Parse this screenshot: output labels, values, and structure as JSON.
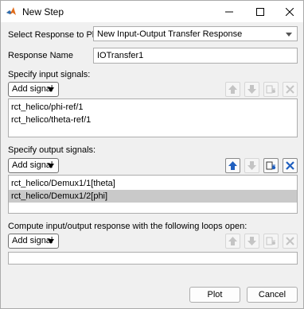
{
  "window": {
    "title": "New Step"
  },
  "response": {
    "label": "Select Response to Plot",
    "selected": "New Input-Output Transfer Response"
  },
  "name": {
    "label": "Response Name",
    "value": "IOTransfer1"
  },
  "inputs": {
    "heading": "Specify input signals:",
    "add_label": "Add signal",
    "items": [
      "rct_helico/phi-ref/1",
      "rct_helico/theta-ref/1"
    ]
  },
  "outputs": {
    "heading": "Specify output signals:",
    "add_label": "Add signal",
    "items": [
      "rct_helico/Demux1/1[theta]",
      "rct_helico/Demux1/2[phi]"
    ],
    "selected_index": 1
  },
  "loops": {
    "heading": "Compute input/output response with the following loops open:",
    "add_label": "Add signal"
  },
  "footer": {
    "plot_label": "Plot",
    "cancel_label": "Cancel"
  },
  "colors": {
    "selected_row": "#c9c9c9",
    "icon_blue": "#1f5fbf",
    "disabled": "#c4c4c4"
  }
}
